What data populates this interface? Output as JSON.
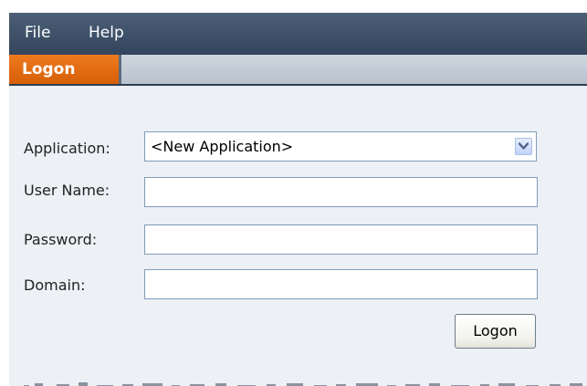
{
  "menubar": {
    "items": [
      {
        "label": "File"
      },
      {
        "label": "Help"
      }
    ]
  },
  "tabs": [
    {
      "label": "Logon",
      "active": true
    }
  ],
  "form": {
    "application": {
      "label": "Application:",
      "selected_value": "<New Application>"
    },
    "user_name": {
      "label": "User Name:",
      "value": ""
    },
    "password": {
      "label": "Password:",
      "value": ""
    },
    "domain": {
      "label": "Domain:",
      "value": ""
    },
    "submit_label": "Logon"
  },
  "colors": {
    "menubar": "#3d5068",
    "tab_active": "#e46c10",
    "panel_background": "#edf0f4",
    "field_border": "#7f9db9"
  },
  "icons": {
    "dropdown": "chevron-down-icon"
  }
}
